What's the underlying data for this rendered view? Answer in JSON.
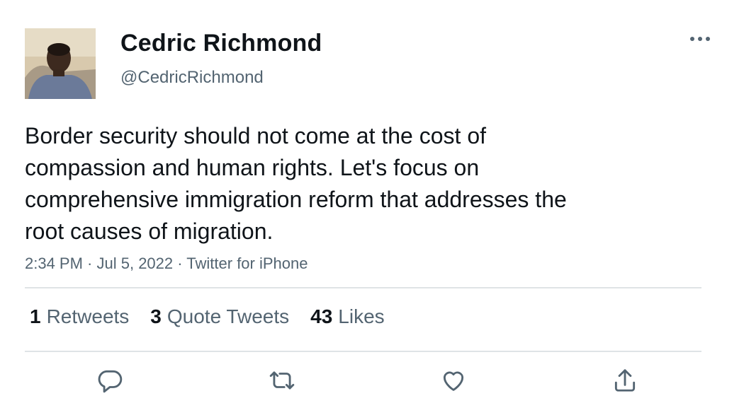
{
  "author": {
    "display_name": "Cedric Richmond",
    "handle": "@CedricRichmond"
  },
  "tweet": {
    "text": "Border security should not come at the cost of\ncompassion and human rights. Let's focus on\ncomprehensive immigration reform that addresses the\nroot causes of migration.",
    "time": "2:34 PM",
    "date": "Jul 5, 2022",
    "source": "Twitter for iPhone",
    "separator": " · "
  },
  "stats": {
    "retweets_count": "1",
    "retweets_label": "Retweets",
    "quotes_count": "3",
    "quotes_label": "Quote Tweets",
    "likes_count": "43",
    "likes_label": "Likes"
  },
  "icons": {
    "more": "more-horizontal-icon",
    "reply": "reply-icon",
    "retweet": "retweet-icon",
    "like": "heart-icon",
    "share": "share-icon"
  },
  "colors": {
    "text_primary": "#0f1419",
    "text_secondary": "#536471",
    "divider": "#dfe3e6",
    "icon": "#536471"
  }
}
